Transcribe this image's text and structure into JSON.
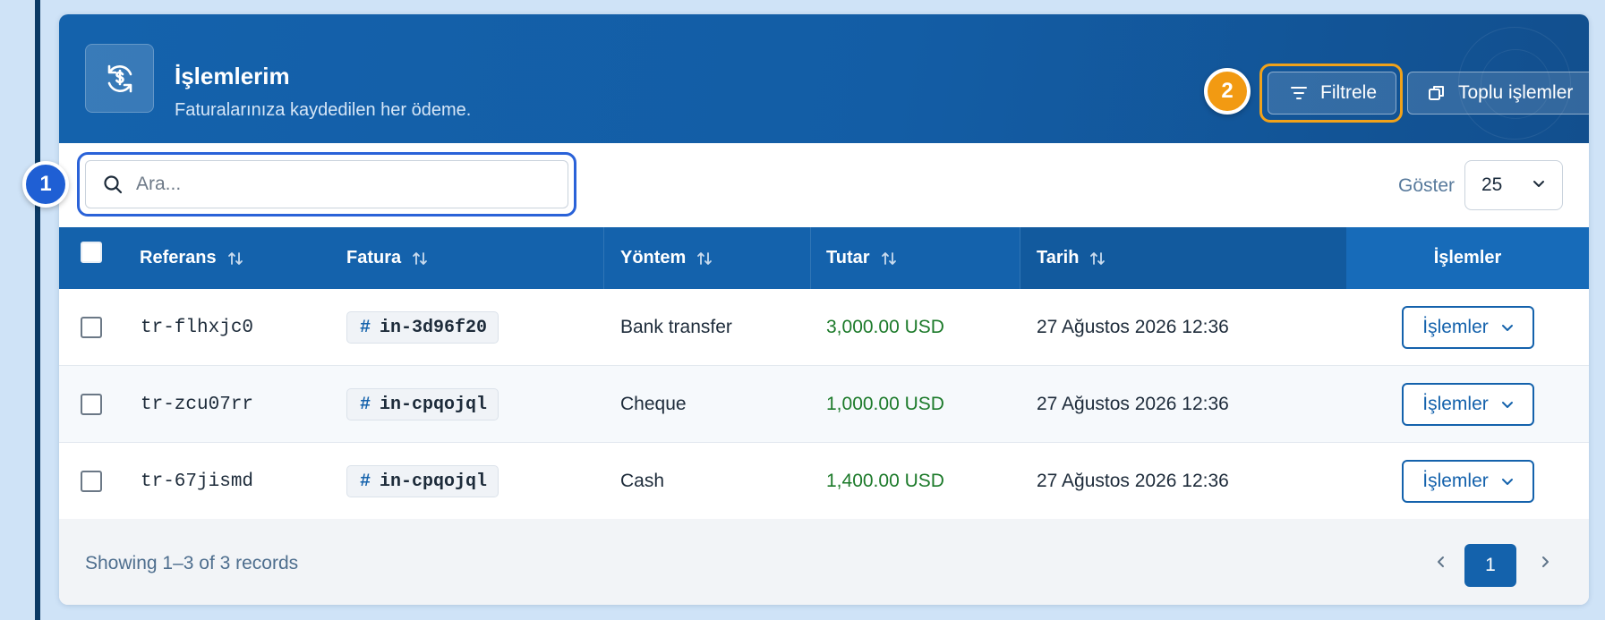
{
  "header": {
    "title": "İşlemlerim",
    "subtitle": "Faturalarınıza kaydedilen her ödeme.",
    "filter_label": "Filtrele",
    "bulk_label": "Toplu işlemler"
  },
  "badges": {
    "search": "1",
    "filter": "2"
  },
  "toolbar": {
    "search_placeholder": "Ara...",
    "show_label": "Göster",
    "page_size": "25"
  },
  "table": {
    "columns": {
      "reference": "Referans",
      "invoice": "Fatura",
      "method": "Yöntem",
      "amount": "Tutar",
      "date": "Tarih",
      "actions": "İşlemler"
    },
    "rows": [
      {
        "reference": "tr-flhxjc0",
        "invoice": "in-3d96f20",
        "method": "Bank transfer",
        "amount": "3,000.00 USD",
        "date": "27 Ağustos 2026 12:36",
        "action_label": "İşlemler"
      },
      {
        "reference": "tr-zcu07rr",
        "invoice": "in-cpqojql",
        "method": "Cheque",
        "amount": "1,000.00 USD",
        "date": "27 Ağustos 2026 12:36",
        "action_label": "İşlemler"
      },
      {
        "reference": "tr-67jismd",
        "invoice": "in-cpqojql",
        "method": "Cash",
        "amount": "1,400.00 USD",
        "date": "27 Ağustos 2026 12:36",
        "action_label": "İşlemler"
      }
    ]
  },
  "footer": {
    "info": "Showing 1–3 of 3 records",
    "current_page": "1"
  },
  "icons": {
    "header": "payment-sync-icon",
    "search": "search-icon",
    "filter": "filter-icon",
    "bulk": "copy-icon",
    "sort": "sort-icon",
    "chevron": "chevron-down-icon",
    "prev": "chevron-left-icon",
    "next": "chevron-right-icon"
  },
  "colors": {
    "primary": "#1462ac",
    "badge_filter": "#f29a12",
    "badge_search": "#1f5fd4",
    "amount": "#1c7a2a"
  }
}
